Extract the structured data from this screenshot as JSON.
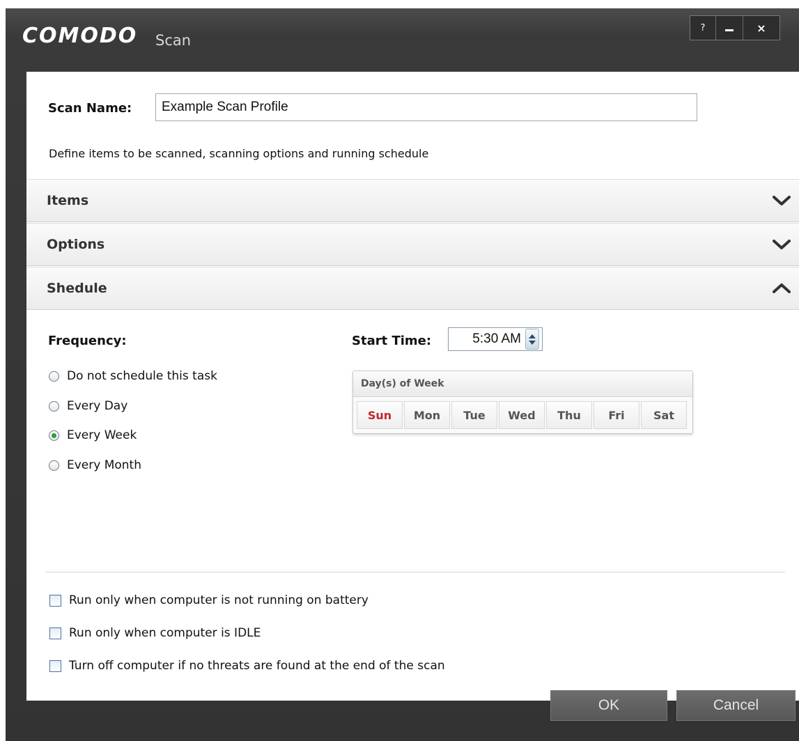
{
  "window": {
    "logo": "COMODO",
    "subtitle": "Scan",
    "controls": {
      "help": "?",
      "minimize": "–",
      "close": "×"
    }
  },
  "scan": {
    "name_label": "Scan Name:",
    "name_value": "Example Scan Profile",
    "description": "Define items to be scanned, scanning options and running schedule"
  },
  "sections": [
    {
      "label": "Items",
      "state": "collapsed",
      "icon": "chevron-down-icon"
    },
    {
      "label": "Options",
      "state": "collapsed",
      "icon": "chevron-down-icon"
    },
    {
      "label": "Shedule",
      "state": "expanded",
      "icon": "chevron-up-icon"
    }
  ],
  "schedule": {
    "frequency_label": "Frequency:",
    "frequency_options": [
      {
        "label": "Do not schedule this task",
        "selected": false
      },
      {
        "label": "Every Day",
        "selected": false
      },
      {
        "label": "Every Week",
        "selected": true
      },
      {
        "label": "Every Month",
        "selected": false
      }
    ],
    "start_time_label": "Start Time:",
    "start_time_value": "5:30 AM",
    "days_header": "Day(s) of Week",
    "days": [
      "Sun",
      "Mon",
      "Tue",
      "Wed",
      "Thu",
      "Fri",
      "Sat"
    ],
    "selected_day": "Sun",
    "selected_day_color": "#c3262b"
  },
  "conditions": [
    {
      "label": "Run only when computer is not running on battery",
      "checked": false
    },
    {
      "label": "Run only when computer is IDLE",
      "checked": false
    },
    {
      "label": "Turn off computer if no threats are found at the end of the scan",
      "checked": false
    }
  ],
  "buttons": {
    "ok": "OK",
    "cancel": "Cancel"
  },
  "colors": {
    "accent_green": "#26a33a",
    "title_bar": "#3a3a3a"
  }
}
